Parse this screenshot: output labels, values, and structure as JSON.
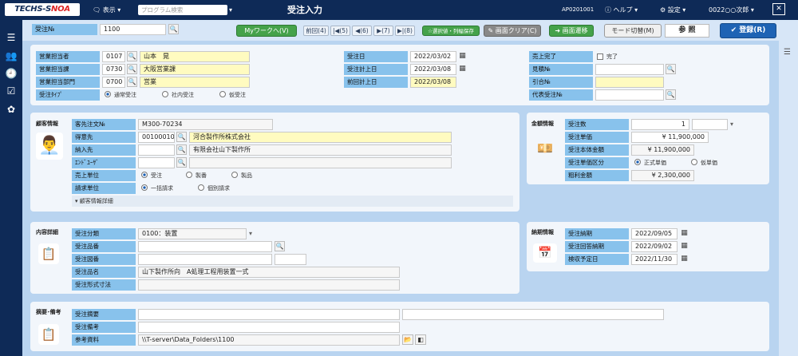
{
  "topbar": {
    "logo_a": "TECHS-S",
    "logo_b": "NOA",
    "display": "表示",
    "program_search": "プログラム検索",
    "title": "受注入力",
    "screen_id": "AP0201001",
    "help": "ヘルプ",
    "settings": "設定",
    "user": "0022○○次郎",
    "close": "✕"
  },
  "rail": {
    "items": [
      "☰",
      "👥",
      "🕘",
      "☑",
      "✿"
    ]
  },
  "toolbar": {
    "order_no_label": "受注№",
    "order_no_value": "1100",
    "my_work": "Myワークへ(V)",
    "prev": "前回(4)",
    "first": "|◀(5)",
    "back": "◀(6)",
    "fwd": "▶(7)",
    "last": "▶|(8)",
    "column_save": "☆選択値・列幅保存",
    "clear": "画面クリア(C)",
    "transition": "画面遷移",
    "mode_switch": "モード切替(M)",
    "mode_value": "参 照",
    "register": "登録(R)"
  },
  "header": {
    "sales_person": {
      "label": "営業担当者",
      "code": "0107",
      "name": "山本　晃"
    },
    "sales_section": {
      "label": "営業担当課",
      "code": "0730",
      "name": "大阪営業課"
    },
    "sales_dept": {
      "label": "営業担当部門",
      "code": "0700",
      "name": "営業"
    },
    "order_type": {
      "label": "受注ﾀｲﾌﾟ",
      "options": [
        "通常受注",
        "社内受注",
        "仮受注"
      ]
    },
    "order_date": {
      "label": "受注日",
      "value": "2022/03/02"
    },
    "order_posting_date": {
      "label": "受注計上日",
      "value": "2022/03/08"
    },
    "prev_posting_date": {
      "label": "前回計上日",
      "value": "2022/03/08"
    },
    "sales_complete": {
      "label": "売上完了",
      "check_label": "完了"
    },
    "estimate_no": {
      "label": "見積№"
    },
    "reference_no": {
      "label": "引合№"
    },
    "rep_order_no": {
      "label": "代表受注№"
    }
  },
  "customer": {
    "title": "顧客情報",
    "po_no": {
      "label": "客先注文№",
      "value": "M300-70234"
    },
    "client": {
      "label": "得意先",
      "code": "00100010",
      "name": "河合製作所株式会社"
    },
    "ship_to": {
      "label": "納入先",
      "name": "有限会社山下製作所"
    },
    "end_user": {
      "label": "ｴﾝﾄﾞﾕｰｻﾞ"
    },
    "sales_unit": {
      "label": "売上単位",
      "options": [
        "受注",
        "製番",
        "製品"
      ]
    },
    "billing_unit": {
      "label": "請求単位",
      "options": [
        "一括請求",
        "個別請求"
      ]
    },
    "detail_link": "▾ 顧客情報詳細"
  },
  "amount": {
    "title": "金額情報",
    "qty": {
      "label": "受注数",
      "value": "1"
    },
    "unit_price": {
      "label": "受注単価",
      "value": "¥ 11,900,000"
    },
    "body_amount": {
      "label": "受注本体金額",
      "value": "¥ 11,900,000"
    },
    "price_type": {
      "label": "受注単価区分",
      "options": [
        "正式単価",
        "仮単価"
      ]
    },
    "gross_profit": {
      "label": "粗利金額",
      "value": "¥ 2,300,000"
    }
  },
  "content": {
    "title": "内容詳細",
    "category": {
      "label": "受注分類",
      "value": "0100：装置"
    },
    "item_no": {
      "label": "受注品番"
    },
    "drawing_no": {
      "label": "受注図番"
    },
    "item_name": {
      "label": "受注品名",
      "value": "山下製作所向　A処理工程用装置一式"
    },
    "spec": {
      "label": "受注形式寸法"
    }
  },
  "delivery": {
    "title": "納期情報",
    "due": {
      "label": "受注納期",
      "value": "2022/09/05"
    },
    "reply_due": {
      "label": "受注回答納期",
      "value": "2022/09/02"
    },
    "inspection": {
      "label": "検収予定日",
      "value": "2022/11/30"
    }
  },
  "notes": {
    "title": "摘要･備考",
    "summary": {
      "label": "受注摘要"
    },
    "remarks": {
      "label": "受注備考"
    },
    "reference": {
      "label": "参考資料",
      "value": "\\\\T-server\\Data_Folders\\1100"
    }
  },
  "colors": {
    "navy": "#0e2a57",
    "label_blue": "#88c2ec",
    "input_yellow": "#fffbc0",
    "green": "#45a24a",
    "primary": "#1e63b4"
  }
}
